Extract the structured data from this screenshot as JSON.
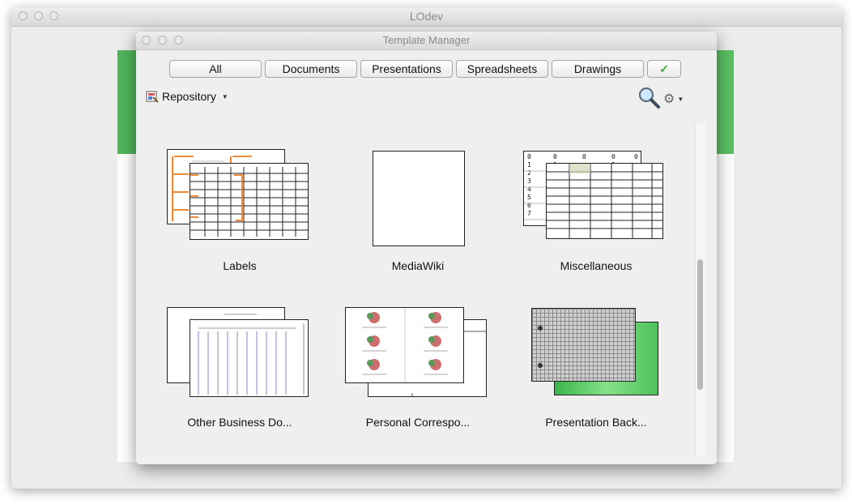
{
  "outer_window": {
    "title": "LOdev"
  },
  "dialog": {
    "title": "Template Manager",
    "filters": [
      "All",
      "Documents",
      "Presentations",
      "Spreadsheets",
      "Drawings"
    ],
    "repository_label": "Repository",
    "templates": [
      {
        "label": "Labels"
      },
      {
        "label": "MediaWiki"
      },
      {
        "label": "Miscellaneous"
      },
      {
        "label": "Other Business Do..."
      },
      {
        "label": "Personal Correspo..."
      },
      {
        "label": "Presentation Back..."
      }
    ]
  },
  "colors": {
    "accent_green": "#5cc062",
    "checkmark": "#3ca535"
  }
}
